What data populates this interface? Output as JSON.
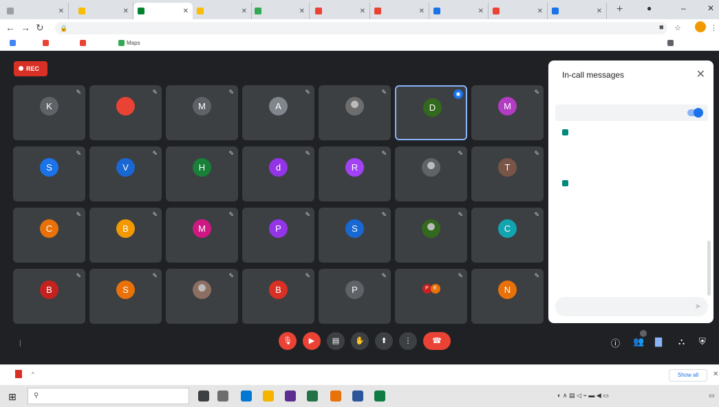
{
  "browser": {
    "tabs": [
      {
        "title": "",
        "color": "#9aa0a6",
        "active": false
      },
      {
        "title": "",
        "color": "#fbbc04",
        "active": false
      },
      {
        "title": "",
        "color": "#00832d",
        "active": true
      },
      {
        "title": "",
        "color": "#fbbc04",
        "active": false
      },
      {
        "title": "",
        "color": "#34a853",
        "active": false
      },
      {
        "title": "",
        "color": "#ea4335",
        "active": false
      },
      {
        "title": "",
        "color": "#ea4335",
        "active": false
      },
      {
        "title": "",
        "color": "#1a73e8",
        "active": false
      },
      {
        "title": "",
        "color": "#ea4335",
        "active": false
      },
      {
        "title": "",
        "color": "#1a73e8",
        "active": false
      }
    ],
    "url": "",
    "bookmarks": [
      {
        "label": "",
        "color": "#4285f4"
      },
      {
        "label": "",
        "color": "#ea4335"
      },
      {
        "label": "",
        "color": "#ea4335"
      },
      {
        "label": "Maps",
        "color": "#34a853"
      }
    ],
    "other_bookmarks": ""
  },
  "meet": {
    "rec_label": "REC",
    "participants": [
      {
        "name": "",
        "initial": "K",
        "color": "#5f6368"
      },
      {
        "name": "",
        "initial": "",
        "color": "#ea4335"
      },
      {
        "name": "",
        "initial": "M",
        "color": "#5f6368"
      },
      {
        "name": "",
        "initial": "A",
        "color": "#80868b"
      },
      {
        "name": "",
        "initial": "",
        "color": "#6d6d6d",
        "photo": true
      },
      {
        "name": "",
        "initial": "D",
        "color": "#33691e",
        "speaking": true
      },
      {
        "name": "",
        "initial": "M",
        "color": "#b23cc2"
      },
      {
        "name": "",
        "initial": "S",
        "color": "#1a73e8"
      },
      {
        "name": "",
        "initial": "V",
        "color": "#1967d2"
      },
      {
        "name": "",
        "initial": "H",
        "color": "#188038"
      },
      {
        "name": "",
        "initial": "d",
        "color": "#9334e6"
      },
      {
        "name": "",
        "initial": "R",
        "color": "#a142f4"
      },
      {
        "name": "",
        "initial": "",
        "color": "#5f6368",
        "photo": true
      },
      {
        "name": "",
        "initial": "T",
        "color": "#795548"
      },
      {
        "name": "",
        "initial": "C",
        "color": "#e8710a"
      },
      {
        "name": "",
        "initial": "B",
        "color": "#f29900"
      },
      {
        "name": "",
        "initial": "M",
        "color": "#d01884"
      },
      {
        "name": "",
        "initial": "P",
        "color": "#9334e6"
      },
      {
        "name": "",
        "initial": "S",
        "color": "#1967d2"
      },
      {
        "name": "",
        "initial": "",
        "color": "#33691e",
        "photo": true
      },
      {
        "name": "",
        "initial": "C",
        "color": "#12a4af"
      },
      {
        "name": "",
        "initial": "B",
        "color": "#c5221f"
      },
      {
        "name": "",
        "initial": "S",
        "color": "#e8710a"
      },
      {
        "name": "",
        "initial": "",
        "color": "#8d6e63",
        "photo": true
      },
      {
        "name": "",
        "initial": "B",
        "color": "#d93025"
      },
      {
        "name": "",
        "initial": "P",
        "color": "#5f6368"
      },
      {
        "name": "",
        "initial": "",
        "color": "#3c4043",
        "others": [
          "P",
          "E"
        ]
      },
      {
        "name": "",
        "initial": "N",
        "color": "#e8710a"
      }
    ],
    "time": "",
    "meeting_title": "",
    "chat": {
      "title": "In-call messages",
      "setting_label": "",
      "messages": [
        {
          "from": "",
          "text": "",
          "emoji": true
        },
        {
          "from": "",
          "text": ""
        },
        {
          "from": "",
          "text": "",
          "emoji": true
        },
        {
          "from": "",
          "text": ""
        },
        {
          "from": "",
          "text": ""
        }
      ],
      "input_placeholder": ""
    }
  },
  "downloads": {
    "file": "",
    "show_all": "Show all"
  },
  "taskbar": {
    "search_placeholder": "",
    "time": "",
    "date": ""
  }
}
